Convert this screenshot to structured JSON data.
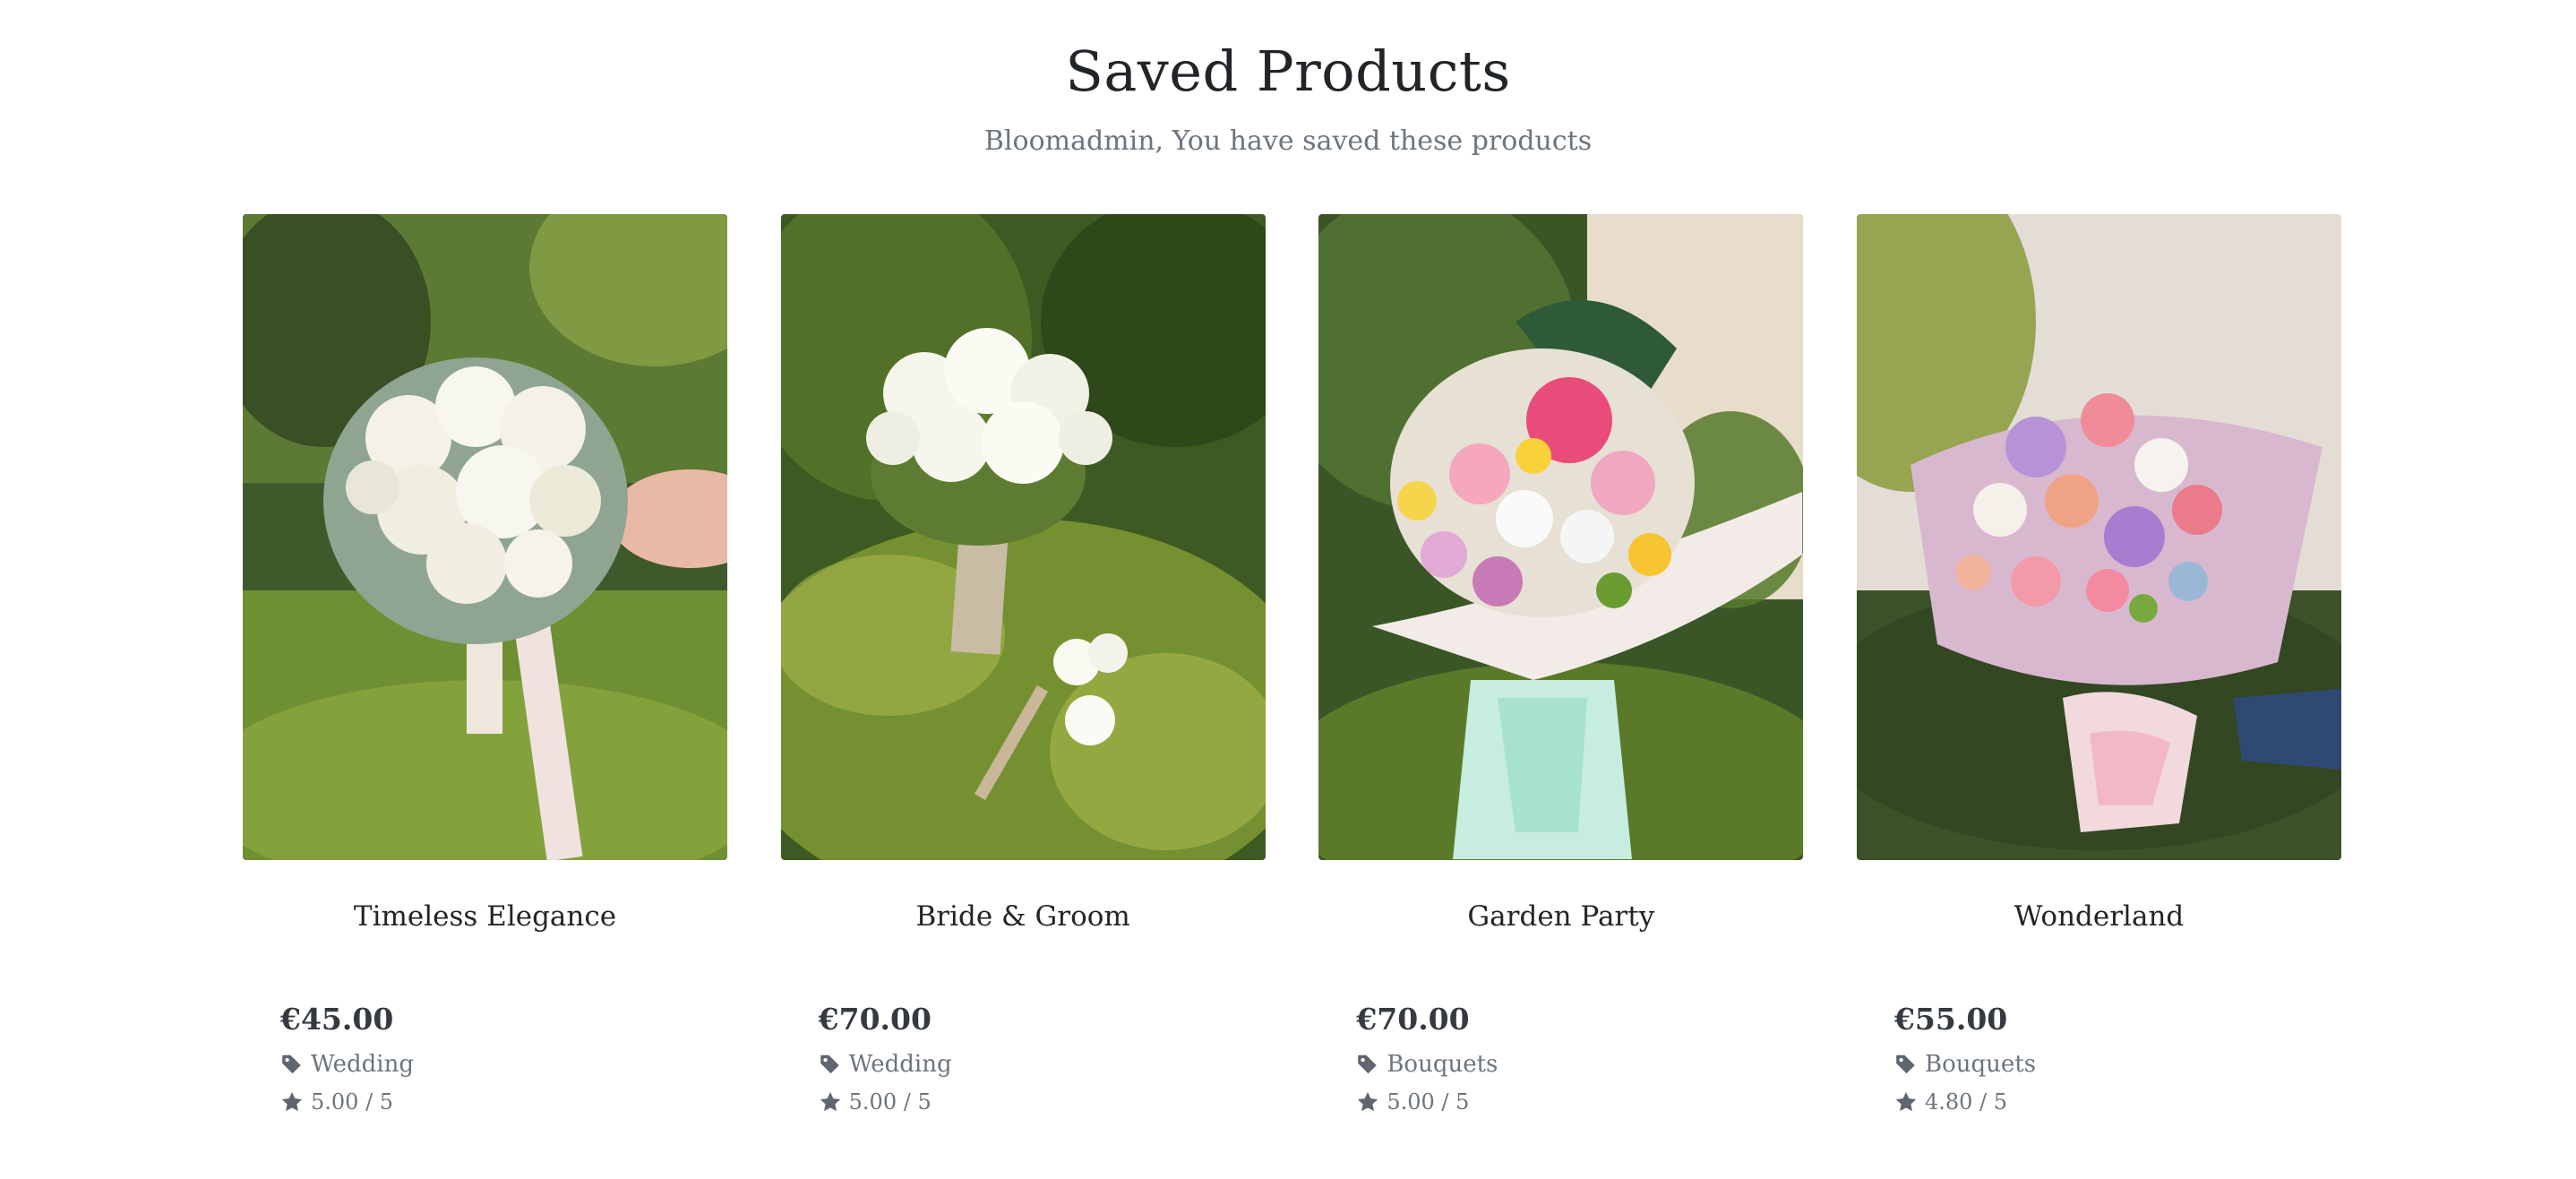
{
  "header": {
    "title": "Saved Products",
    "subtitle": "Bloomadmin, You have saved these products"
  },
  "products": [
    {
      "name": "Timeless Elegance",
      "price": "€45.00",
      "category": "Wedding",
      "rating": "5.00 / 5",
      "image": "white-roses-bridal-bouquet"
    },
    {
      "name": "Bride & Groom",
      "price": "€70.00",
      "category": "Wedding",
      "rating": "5.00 / 5",
      "image": "white-freesia-bouquet-and-boutonniere"
    },
    {
      "name": "Garden Party",
      "price": "€70.00",
      "category": "Bouquets",
      "rating": "5.00 / 5",
      "image": "mixed-pink-and-yellow-bouquet"
    },
    {
      "name": "Wonderland",
      "price": "€55.00",
      "category": "Bouquets",
      "rating": "4.80 / 5",
      "image": "pink-wrapped-mixed-bouquet"
    }
  ],
  "colors": {
    "text": "#212529",
    "muted": "#6c757d",
    "icon": "#5f6670"
  },
  "icons": {
    "category": "tag-icon",
    "rating": "star-icon"
  }
}
